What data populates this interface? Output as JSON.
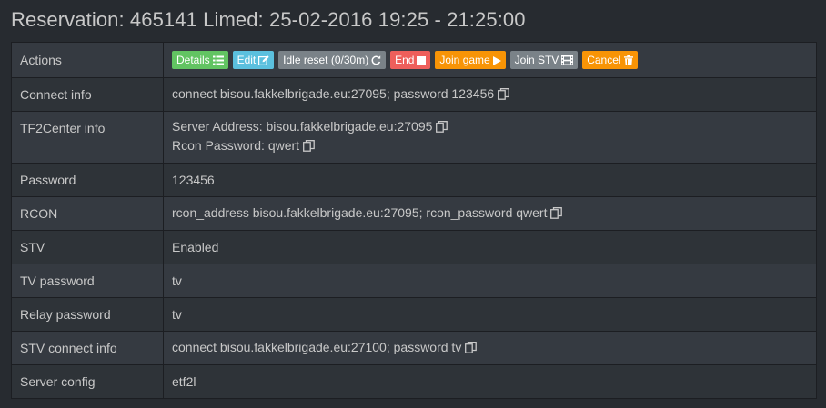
{
  "title": "Reservation: 465141 Limed: 25-02-2016 19:25 - 21:25:00",
  "actions": {
    "label": "Actions",
    "buttons": {
      "details": "Details",
      "edit": "Edit",
      "idle_reset": "Idle reset (0/30m)",
      "end": "End",
      "join_game": "Join game",
      "join_stv": "Join STV",
      "cancel": "Cancel"
    }
  },
  "rows": {
    "connect_info": {
      "key": "Connect info",
      "value": "connect bisou.fakkelbrigade.eu:27095; password 123456"
    },
    "tf2center_info": {
      "key": "TF2Center info",
      "server_address": "Server Address: bisou.fakkelbrigade.eu:27095",
      "rcon_password": "Rcon Password: qwert"
    },
    "password": {
      "key": "Password",
      "value": "123456"
    },
    "rcon": {
      "key": "RCON",
      "value": "rcon_address bisou.fakkelbrigade.eu:27095; rcon_password qwert"
    },
    "stv": {
      "key": "STV",
      "value": "Enabled"
    },
    "tv_password": {
      "key": "TV password",
      "value": "tv"
    },
    "relay_password": {
      "key": "Relay password",
      "value": "tv"
    },
    "stv_connect_info": {
      "key": "STV connect info",
      "value": "connect bisou.fakkelbrigade.eu:27100; password tv"
    },
    "server_config": {
      "key": "Server config",
      "value": "etf2l"
    }
  },
  "icons": {
    "details": "list-icon",
    "edit": "edit-icon",
    "idle_reset": "refresh-icon",
    "end": "stop-icon",
    "join_game": "play-icon",
    "join_stv": "film-icon",
    "cancel": "trash-icon",
    "copy": "copy-icon"
  },
  "colors": {
    "background": "#272b30",
    "row_odd": "#353a41",
    "row_even": "#2e3338",
    "success": "#62c462",
    "info": "#5bc0de",
    "default": "#7a8288",
    "danger": "#ee5f5b",
    "warning": "#f89406"
  }
}
